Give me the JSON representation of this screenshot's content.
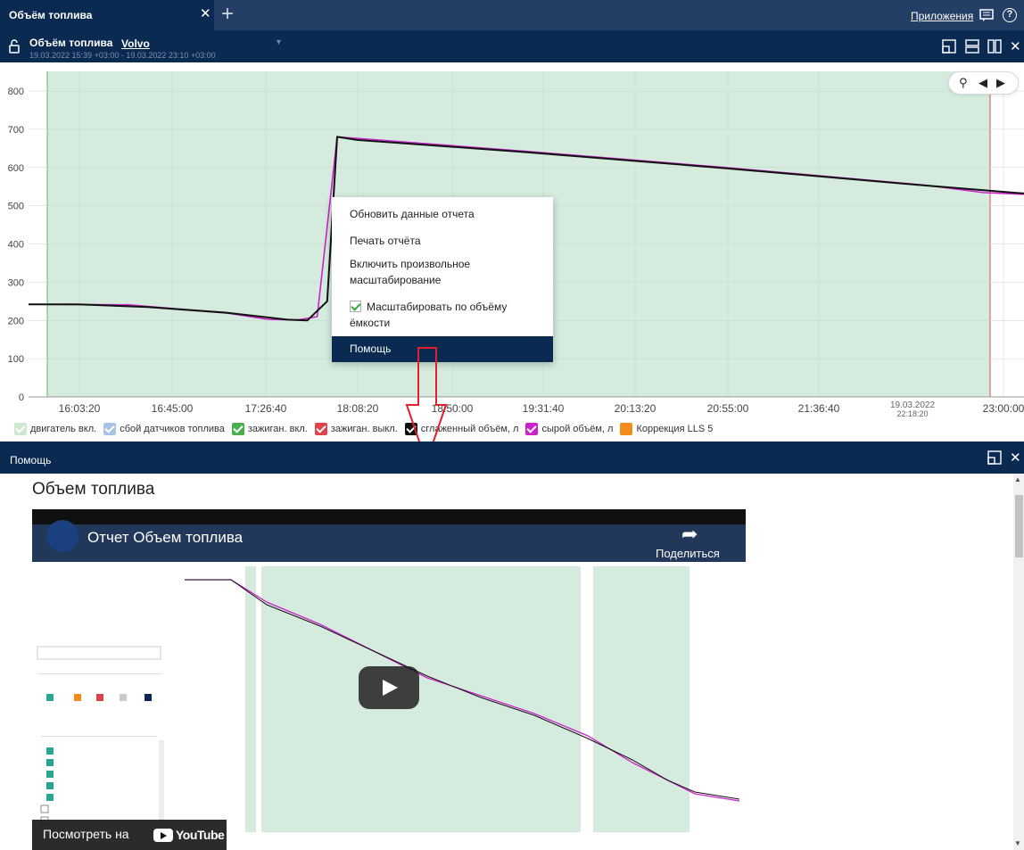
{
  "tab": {
    "title": "Объём топлива",
    "close": "✕",
    "add": "+"
  },
  "topbar": {
    "apps_label": "Приложения",
    "help_icon_label": "?"
  },
  "report": {
    "title": "Объём топлива",
    "unit": "Volvo",
    "range": "19.03.2022 15:39 +03:00 - 19.03.2022 23:10 +03:00",
    "close": "✕"
  },
  "chart_data": {
    "type": "line",
    "ylim": [
      0,
      800
    ],
    "y_ticks": [
      "0",
      "100",
      "200",
      "300",
      "400",
      "500",
      "600",
      "700",
      "800"
    ],
    "x_ticks": [
      "16:03:20",
      "16:45:00",
      "17:26:40",
      "18:08:20",
      "18:50:00",
      "19:31:40",
      "20:13:20",
      "20:55:00",
      "21:36:40",
      "23:00:00"
    ],
    "x_tick_date": {
      "date": "19.03.2022",
      "time": "22:18:20"
    },
    "grid": true,
    "ignition_on_band": {
      "color": "#d4ebdd"
    },
    "series": [
      {
        "name": "сглаженный объём, л",
        "color": "#111111",
        "points": [
          [
            0,
            242
          ],
          [
            0.05,
            242
          ],
          [
            0.12,
            235
          ],
          [
            0.2,
            220
          ],
          [
            0.26,
            202
          ],
          [
            0.28,
            200
          ],
          [
            0.3,
            250
          ],
          [
            0.31,
            680
          ],
          [
            0.33,
            672
          ],
          [
            0.5,
            640
          ],
          [
            0.7,
            598
          ],
          [
            0.9,
            553
          ],
          [
            1.0,
            532
          ]
        ]
      },
      {
        "name": "сырой объём, л",
        "color": "#cc22cc",
        "points": [
          [
            0,
            242
          ],
          [
            0.1,
            241
          ],
          [
            0.2,
            219
          ],
          [
            0.24,
            203
          ],
          [
            0.27,
            201
          ],
          [
            0.29,
            210
          ],
          [
            0.31,
            680
          ],
          [
            0.5,
            642
          ],
          [
            0.7,
            600
          ],
          [
            0.9,
            554
          ],
          [
            0.96,
            534
          ],
          [
            1.0,
            530
          ]
        ]
      }
    ],
    "legend": [
      {
        "label": "двигатель вкл.",
        "color": "#cfe6d1",
        "checked": true
      },
      {
        "label": "сбой датчиков топлива",
        "color": "#a9c3e6",
        "checked": true
      },
      {
        "label": "зажиган. вкл.",
        "color": "#4cae4f",
        "checked": true
      },
      {
        "label": "зажиган. выкл.",
        "color": "#e0414a",
        "checked": true
      },
      {
        "label": "сглаженный объём, л",
        "color": "#111111",
        "checked": true
      },
      {
        "label": "сырой объём, л",
        "color": "#cc22cc",
        "checked": true
      },
      {
        "label": "Коррекция LLS 5",
        "color": "#f28c1c",
        "checked": false
      }
    ]
  },
  "zoom": {
    "zoom_icon": "⚲",
    "prev": "◀",
    "next": "▶"
  },
  "context_menu": {
    "items": [
      {
        "label": "Обновить данные отчета"
      },
      {
        "label": "Печать отчёта"
      },
      {
        "label": "Включить произвольное масштабирование"
      },
      {
        "label": "Масштабировать по объёму ёмкости",
        "checked": true
      },
      {
        "label": "Помощь",
        "active": true
      }
    ]
  },
  "help_panel": {
    "title": "Помощь",
    "heading": "Объем топлива",
    "close": "✕",
    "video": {
      "title": "Отчет Объем топлива",
      "share": "Поделиться",
      "watch_on": "Посмотреть на",
      "youtube": "YouTube"
    }
  }
}
